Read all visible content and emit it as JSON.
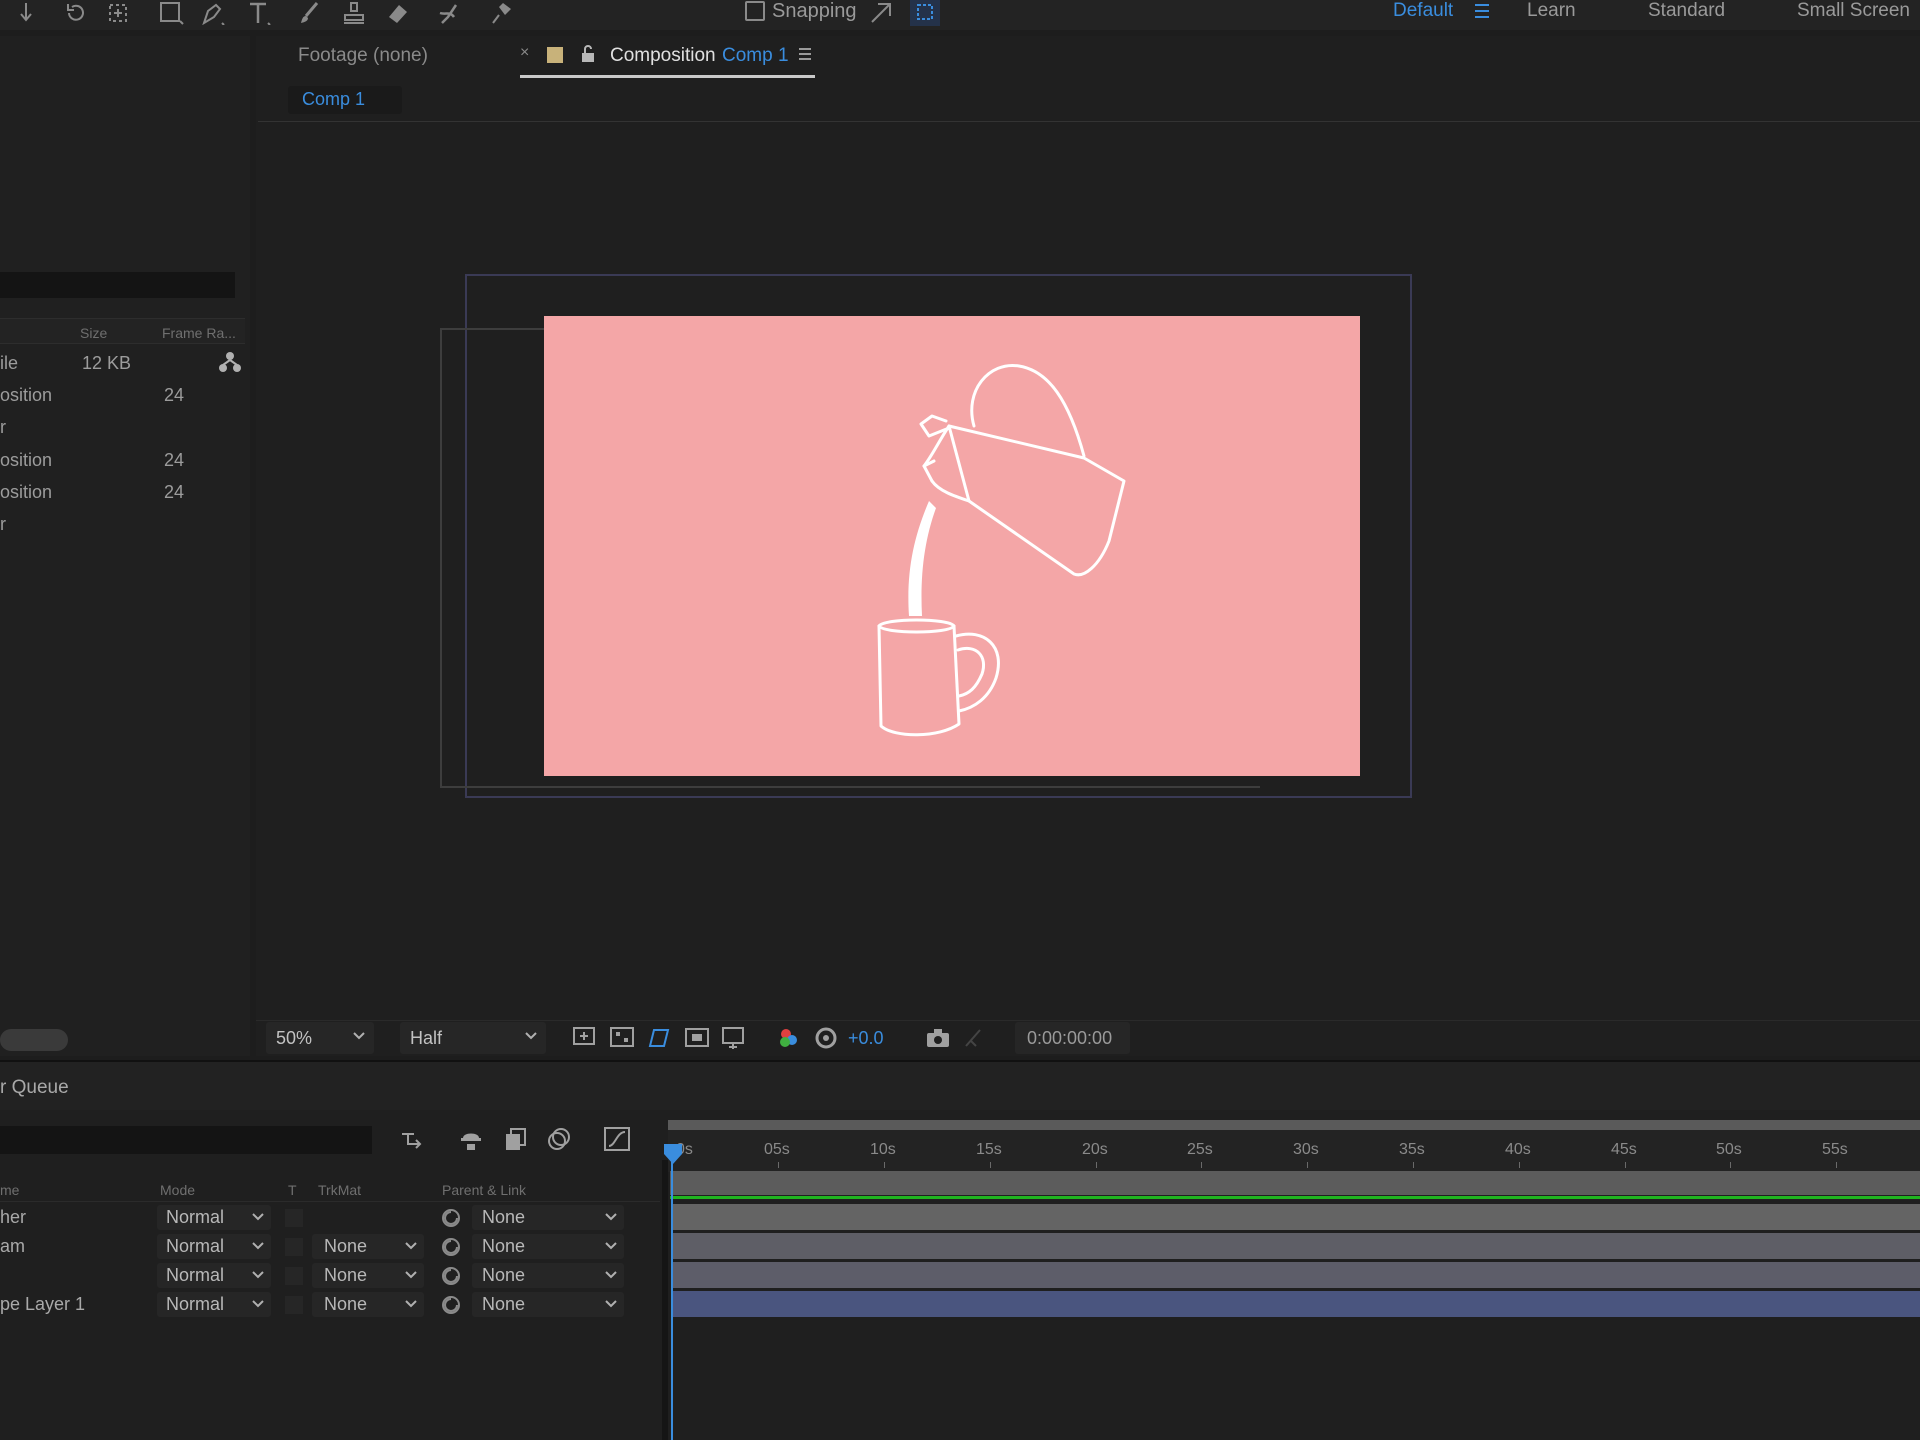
{
  "toolbar": {
    "snapping_label": "Snapping",
    "workspaces": [
      "Default",
      "Learn",
      "Standard",
      "Small Screen"
    ],
    "active_workspace": "Default",
    "tools": [
      "selection-tool",
      "rotate-tool",
      "anchor-tool",
      "rectangle-tool",
      "pen-tool",
      "type-tool",
      "brush-tool",
      "clone-stamp-tool",
      "eraser-tool",
      "roto-brush-tool",
      "puppet-tool"
    ]
  },
  "project": {
    "col_size": "Size",
    "col_frame_rate": "Frame Ra...",
    "rows": [
      {
        "name": "ile",
        "size": "12 KB",
        "fps": ""
      },
      {
        "name": "osition",
        "size": "",
        "fps": "24"
      },
      {
        "name": "r",
        "size": "",
        "fps": ""
      },
      {
        "name": "osition",
        "size": "",
        "fps": "24"
      },
      {
        "name": "osition",
        "size": "",
        "fps": "24"
      },
      {
        "name": "r",
        "size": "",
        "fps": ""
      }
    ]
  },
  "viewer": {
    "footage_tab": "Footage (none)",
    "comp_tab_prefix": "Composition",
    "comp_tab_name": "Comp 1",
    "breadcrumb": "Comp 1",
    "canvas_color": "#f4a6a7",
    "zoom": "50%",
    "resolution": "Half",
    "exposure": "+0.0",
    "timecode": "0:00:00:00"
  },
  "render_queue": {
    "label": "r Queue"
  },
  "timeline": {
    "headers": {
      "name": "me",
      "mode": "Mode",
      "t": "T",
      "trkmat": "TrkMat",
      "parent": "Parent & Link"
    },
    "ticks": [
      "0s",
      "05s",
      "10s",
      "15s",
      "20s",
      "25s",
      "30s",
      "35s",
      "40s",
      "45s",
      "50s",
      "55s"
    ],
    "layers": [
      {
        "name": "her",
        "mode": "Normal",
        "trkmat": "",
        "parent": "None"
      },
      {
        "name": "am",
        "mode": "Normal",
        "trkmat": "None",
        "parent": "None"
      },
      {
        "name": "",
        "mode": "Normal",
        "trkmat": "None",
        "parent": "None"
      },
      {
        "name": "pe Layer 1",
        "mode": "Normal",
        "trkmat": "None",
        "parent": "None"
      }
    ],
    "bar_colors": [
      "#646464",
      "#5e5e66",
      "#5d5d69",
      "#4a557f"
    ]
  }
}
